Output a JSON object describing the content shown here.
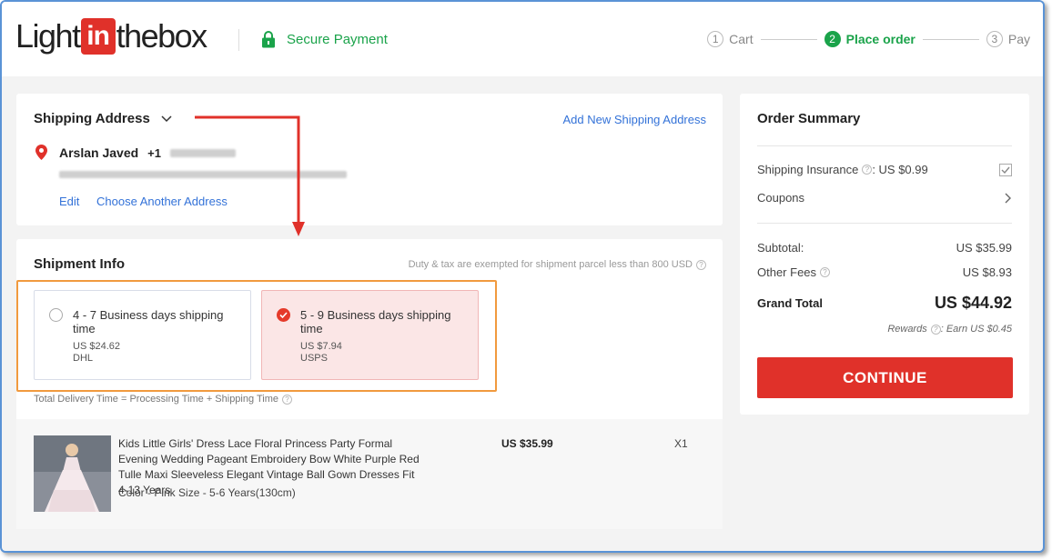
{
  "header": {
    "logo": {
      "left": "Light",
      "box": "in",
      "right": "thebox"
    },
    "secure_label": "Secure Payment",
    "steps": [
      {
        "num": "1",
        "label": "Cart"
      },
      {
        "num": "2",
        "label": "Place order"
      },
      {
        "num": "3",
        "label": "Pay"
      }
    ]
  },
  "shipping_address": {
    "title": "Shipping Address",
    "add_new": "Add New Shipping Address",
    "name": "Arslan Javed",
    "phone_prefix": "+1",
    "edit": "Edit",
    "choose_another": "Choose Another Address"
  },
  "shipment_info": {
    "title": "Shipment Info",
    "duty_note": "Duty & tax are exempted for shipment parcel less than 800 USD",
    "options": [
      {
        "title": "4 - 7 Business days shipping time",
        "price": "US $24.62",
        "carrier": "DHL",
        "selected": false
      },
      {
        "title": "5 - 9 Business days shipping time",
        "price": "US $7.94",
        "carrier": "USPS",
        "selected": true
      }
    ],
    "delivery_note": "Total Delivery Time = Processing Time + Shipping Time"
  },
  "product": {
    "title": "Kids Little Girls' Dress Lace Floral Princess Party Formal Evening Wedding Pageant Embroidery Bow White Purple Red Tulle Maxi Sleeveless Elegant Vintage Ball Gown Dresses Fit 4-13 Years",
    "variant": "Color - Pink  Size - 5-6 Years(130cm)",
    "price": "US $35.99",
    "qty": "X1"
  },
  "summary": {
    "title": "Order Summary",
    "insurance_label": "Shipping Insurance",
    "insurance_value": ": US $0.99",
    "coupons": "Coupons",
    "subtotal_label": "Subtotal:",
    "subtotal_value": "US $35.99",
    "other_fees_label": "Other Fees",
    "other_fees_value": "US $8.93",
    "grand_total_label": "Grand Total",
    "grand_total_value": "US $44.92",
    "rewards_label": "Rewards",
    "rewards_value": ": Earn US $0.45",
    "continue": "CONTINUE"
  },
  "colors": {
    "accent_red": "#e0312a",
    "green": "#1aa34a",
    "link_blue": "#3372d8",
    "annotation_orange": "#f19a3e"
  }
}
